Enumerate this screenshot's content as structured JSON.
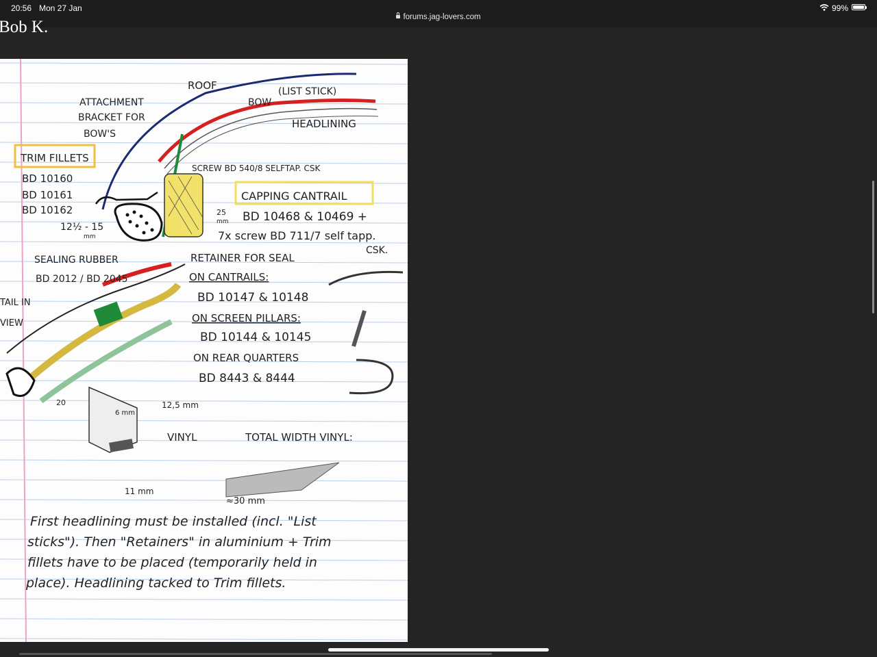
{
  "status_bar": {
    "time": "20:56",
    "date": "Mon 27 Jan",
    "url": "forums.jag-lovers.com",
    "battery": "99%"
  },
  "post": {
    "author_partial": "Bob K."
  },
  "note": {
    "labels": {
      "roof": "ROOF",
      "bow": "BOW",
      "list_stick": "(LIST STICK)",
      "headlining": "HEADLINING",
      "attachment_1": "ATTACHMENT",
      "attachment_2": "BRACKET FOR",
      "attachment_3": "BOW'S",
      "trim_fillets": "TRIM FILLETS",
      "bd1": "BD 10160",
      "bd2": "BD 10161",
      "bd3": "BD 10162",
      "screw": "SCREW BD 540/8 SELFTAP. CSK",
      "capping": "CAPPING CANTRAIL",
      "dim25": "25",
      "dim_mm": "mm",
      "bd_capping": "BD 10468 & 10469 +",
      "screw7": "7x screw BD 711/7 self tapp.",
      "csk": "CSK.",
      "dim_12": "12½ - 15",
      "dim_12_mm": "mm",
      "sealing": "SEALING RUBBER",
      "sealing_bd": "BD 2012 / BD 2045",
      "retainer": "RETAINER FOR SEAL",
      "cantrails": "ON CANTRAILS:",
      "cantrails_bd": "BD 10147 & 10148",
      "screen": "ON SCREEN PILLARS:",
      "screen_bd": "BD 10144 & 10145",
      "rear": "ON REAR QUARTERS",
      "rear_bd": "BD 8443 & 8444",
      "detail_1": "TAIL IN",
      "detail_2": "VIEW",
      "dim20": "20",
      "dim6": "6 mm",
      "dim125": "12,5 mm",
      "vinyl": "VINYL",
      "total": "TOTAL WIDTH VINYL:",
      "dim11": "11 mm",
      "dim30": "≈30 mm"
    },
    "paragraph": [
      "First headlining must be installed (incl. \"List",
      "sticks\"). Then \"Retainers\" in aluminium + Trim",
      "fillets have to be placed (temporarily held in",
      "place). Headlining tacked to Trim fillets."
    ]
  }
}
